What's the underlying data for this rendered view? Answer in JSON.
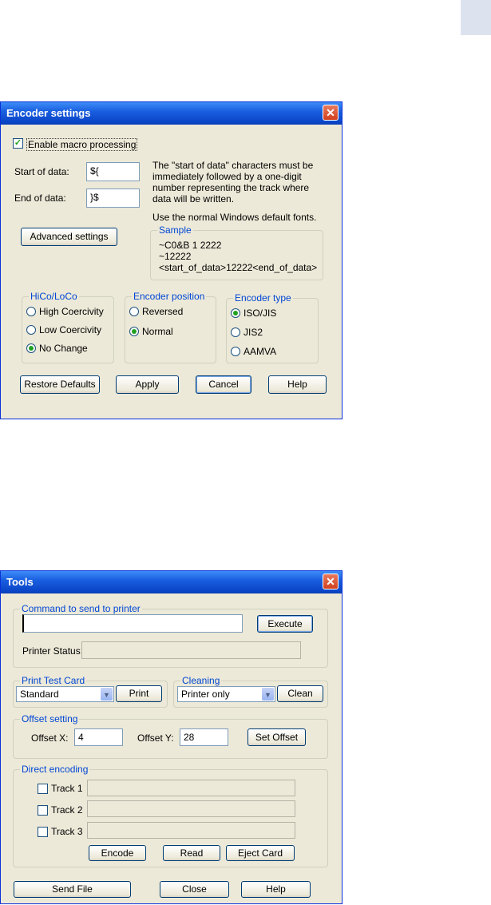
{
  "encoder": {
    "title": "Encoder settings",
    "enable_macro_label": "Enable macro processing",
    "enable_macro_checked": true,
    "start_label": "Start of data:",
    "start_value": "${",
    "end_label": "End of data:",
    "end_value": "}$",
    "info_line1": "The \"start of data\" characters must be",
    "info_line2": "immediately followed by a one-digit",
    "info_line3": "number representing the track where",
    "info_line4": "data will be written.",
    "info_fonts": "Use the normal Windows default fonts.",
    "advanced_button": "Advanced settings",
    "sample_legend": "Sample",
    "sample_line1": "~C0&B 1 2222",
    "sample_line2": "~12222",
    "sample_line3": "<start_of_data>12222<end_of_data>",
    "hico": {
      "legend": "HiCo/LoCo",
      "options": [
        "High Coercivity",
        "Low Coercivity",
        "No Change"
      ],
      "selected": "No Change"
    },
    "position": {
      "legend": "Encoder position",
      "options": [
        "Reversed",
        "Normal"
      ],
      "selected": "Normal"
    },
    "type": {
      "legend": "Encoder type",
      "options": [
        "ISO/JIS",
        "JIS2",
        "AAMVA"
      ],
      "selected": "ISO/JIS"
    },
    "buttons": {
      "restore": "Restore Defaults",
      "apply": "Apply",
      "cancel": "Cancel",
      "help": "Help"
    }
  },
  "tools": {
    "title": "Tools",
    "command_legend": "Command to send to printer",
    "command_value": "",
    "execute_button": "Execute",
    "printer_status_label": "Printer Status:",
    "printer_status_value": "",
    "print_test_legend": "Print Test Card",
    "print_test_value": "Standard",
    "print_button": "Print",
    "cleaning_legend": "Cleaning",
    "cleaning_value": "Printer only",
    "clean_button": "Clean",
    "offset_legend": "Offset setting",
    "offset_x_label": "Offset X:",
    "offset_x_value": "4",
    "offset_y_label": "Offset Y:",
    "offset_y_value": "28",
    "set_offset_button": "Set Offset",
    "direct_legend": "Direct encoding",
    "track1_label": "Track 1",
    "track2_label": "Track 2",
    "track3_label": "Track 3",
    "encode_button": "Encode",
    "read_button": "Read",
    "eject_button": "Eject Card",
    "send_file_button": "Send File",
    "close_button": "Close",
    "help_button": "Help"
  }
}
